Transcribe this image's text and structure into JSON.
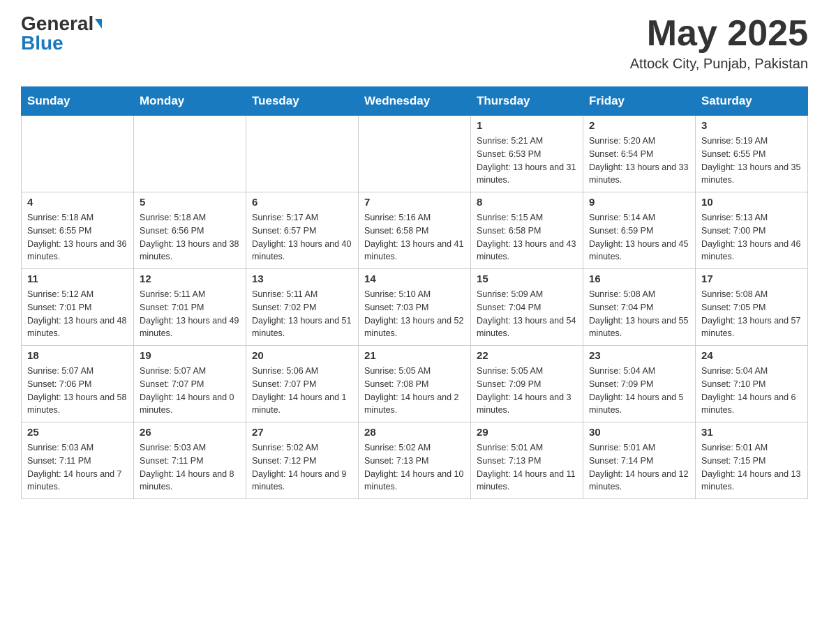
{
  "header": {
    "logo_general": "General",
    "logo_blue": "Blue",
    "month_title": "May 2025",
    "location": "Attock City, Punjab, Pakistan"
  },
  "days_of_week": [
    "Sunday",
    "Monday",
    "Tuesday",
    "Wednesday",
    "Thursday",
    "Friday",
    "Saturday"
  ],
  "weeks": [
    [
      {
        "day": "",
        "info": ""
      },
      {
        "day": "",
        "info": ""
      },
      {
        "day": "",
        "info": ""
      },
      {
        "day": "",
        "info": ""
      },
      {
        "day": "1",
        "info": "Sunrise: 5:21 AM\nSunset: 6:53 PM\nDaylight: 13 hours and 31 minutes."
      },
      {
        "day": "2",
        "info": "Sunrise: 5:20 AM\nSunset: 6:54 PM\nDaylight: 13 hours and 33 minutes."
      },
      {
        "day": "3",
        "info": "Sunrise: 5:19 AM\nSunset: 6:55 PM\nDaylight: 13 hours and 35 minutes."
      }
    ],
    [
      {
        "day": "4",
        "info": "Sunrise: 5:18 AM\nSunset: 6:55 PM\nDaylight: 13 hours and 36 minutes."
      },
      {
        "day": "5",
        "info": "Sunrise: 5:18 AM\nSunset: 6:56 PM\nDaylight: 13 hours and 38 minutes."
      },
      {
        "day": "6",
        "info": "Sunrise: 5:17 AM\nSunset: 6:57 PM\nDaylight: 13 hours and 40 minutes."
      },
      {
        "day": "7",
        "info": "Sunrise: 5:16 AM\nSunset: 6:58 PM\nDaylight: 13 hours and 41 minutes."
      },
      {
        "day": "8",
        "info": "Sunrise: 5:15 AM\nSunset: 6:58 PM\nDaylight: 13 hours and 43 minutes."
      },
      {
        "day": "9",
        "info": "Sunrise: 5:14 AM\nSunset: 6:59 PM\nDaylight: 13 hours and 45 minutes."
      },
      {
        "day": "10",
        "info": "Sunrise: 5:13 AM\nSunset: 7:00 PM\nDaylight: 13 hours and 46 minutes."
      }
    ],
    [
      {
        "day": "11",
        "info": "Sunrise: 5:12 AM\nSunset: 7:01 PM\nDaylight: 13 hours and 48 minutes."
      },
      {
        "day": "12",
        "info": "Sunrise: 5:11 AM\nSunset: 7:01 PM\nDaylight: 13 hours and 49 minutes."
      },
      {
        "day": "13",
        "info": "Sunrise: 5:11 AM\nSunset: 7:02 PM\nDaylight: 13 hours and 51 minutes."
      },
      {
        "day": "14",
        "info": "Sunrise: 5:10 AM\nSunset: 7:03 PM\nDaylight: 13 hours and 52 minutes."
      },
      {
        "day": "15",
        "info": "Sunrise: 5:09 AM\nSunset: 7:04 PM\nDaylight: 13 hours and 54 minutes."
      },
      {
        "day": "16",
        "info": "Sunrise: 5:08 AM\nSunset: 7:04 PM\nDaylight: 13 hours and 55 minutes."
      },
      {
        "day": "17",
        "info": "Sunrise: 5:08 AM\nSunset: 7:05 PM\nDaylight: 13 hours and 57 minutes."
      }
    ],
    [
      {
        "day": "18",
        "info": "Sunrise: 5:07 AM\nSunset: 7:06 PM\nDaylight: 13 hours and 58 minutes."
      },
      {
        "day": "19",
        "info": "Sunrise: 5:07 AM\nSunset: 7:07 PM\nDaylight: 14 hours and 0 minutes."
      },
      {
        "day": "20",
        "info": "Sunrise: 5:06 AM\nSunset: 7:07 PM\nDaylight: 14 hours and 1 minute."
      },
      {
        "day": "21",
        "info": "Sunrise: 5:05 AM\nSunset: 7:08 PM\nDaylight: 14 hours and 2 minutes."
      },
      {
        "day": "22",
        "info": "Sunrise: 5:05 AM\nSunset: 7:09 PM\nDaylight: 14 hours and 3 minutes."
      },
      {
        "day": "23",
        "info": "Sunrise: 5:04 AM\nSunset: 7:09 PM\nDaylight: 14 hours and 5 minutes."
      },
      {
        "day": "24",
        "info": "Sunrise: 5:04 AM\nSunset: 7:10 PM\nDaylight: 14 hours and 6 minutes."
      }
    ],
    [
      {
        "day": "25",
        "info": "Sunrise: 5:03 AM\nSunset: 7:11 PM\nDaylight: 14 hours and 7 minutes."
      },
      {
        "day": "26",
        "info": "Sunrise: 5:03 AM\nSunset: 7:11 PM\nDaylight: 14 hours and 8 minutes."
      },
      {
        "day": "27",
        "info": "Sunrise: 5:02 AM\nSunset: 7:12 PM\nDaylight: 14 hours and 9 minutes."
      },
      {
        "day": "28",
        "info": "Sunrise: 5:02 AM\nSunset: 7:13 PM\nDaylight: 14 hours and 10 minutes."
      },
      {
        "day": "29",
        "info": "Sunrise: 5:01 AM\nSunset: 7:13 PM\nDaylight: 14 hours and 11 minutes."
      },
      {
        "day": "30",
        "info": "Sunrise: 5:01 AM\nSunset: 7:14 PM\nDaylight: 14 hours and 12 minutes."
      },
      {
        "day": "31",
        "info": "Sunrise: 5:01 AM\nSunset: 7:15 PM\nDaylight: 14 hours and 13 minutes."
      }
    ]
  ]
}
